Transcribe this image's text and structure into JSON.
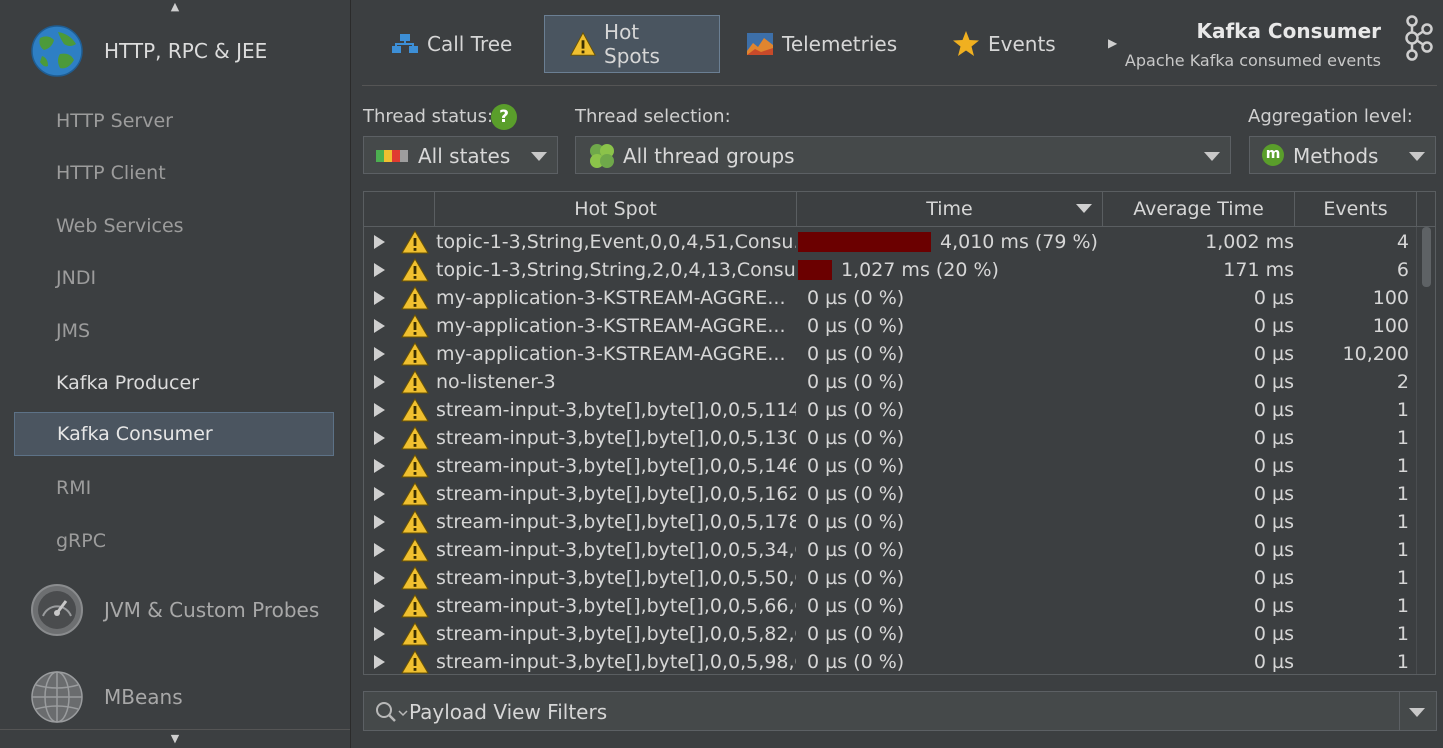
{
  "sidebar": {
    "categories": [
      {
        "label": "HTTP, RPC & JEE",
        "icon": "globe-icon"
      },
      {
        "label": "JVM & Custom Probes",
        "icon": "gauge-icon"
      },
      {
        "label": "MBeans",
        "icon": "wireframe-globe-icon"
      }
    ],
    "items": [
      {
        "label": "HTTP Server"
      },
      {
        "label": "HTTP Client"
      },
      {
        "label": "Web Services"
      },
      {
        "label": "JNDI"
      },
      {
        "label": "JMS"
      },
      {
        "label": "Kafka Producer"
      },
      {
        "label": "Kafka Consumer",
        "selected": true
      },
      {
        "label": "RMI"
      },
      {
        "label": "gRPC"
      }
    ]
  },
  "tabs": [
    {
      "label": "Call Tree",
      "icon": "call-tree-icon"
    },
    {
      "label": "Hot Spots",
      "icon": "warning-icon",
      "active": true
    },
    {
      "label": "Telemetries",
      "icon": "telemetry-chart-icon"
    },
    {
      "label": "Events",
      "icon": "star-icon"
    }
  ],
  "view": {
    "title": "Kafka Consumer",
    "subtitle": "Apache Kafka consumed events"
  },
  "filters": {
    "thread_status_label": "Thread status:",
    "thread_status_help": "?",
    "thread_status_value": "All states",
    "thread_selection_label": "Thread selection:",
    "thread_selection_value": "All thread groups",
    "aggregation_label": "Aggregation level:",
    "aggregation_badge": "m",
    "aggregation_value": "Methods"
  },
  "table": {
    "columns": [
      "Hot Spot",
      "Time",
      "Average Time",
      "Events"
    ],
    "sort_column": "Time",
    "rows": [
      {
        "name": "topic-1-3,String,Event,0,0,4,51,Consu...",
        "bar_fraction": 0.79,
        "time": "4,010 ms (79 %)",
        "avg": "1,002 ms",
        "events": "4"
      },
      {
        "name": "topic-1-3,String,String,2,0,4,13,Consu...",
        "bar_fraction": 0.2,
        "time": "1,027 ms (20 %)",
        "avg": "171 ms",
        "events": "6"
      },
      {
        "name": "my-application-3-KSTREAM-AGGRE...",
        "bar_fraction": 0,
        "time": "0 µs (0 %)",
        "avg": "0 µs",
        "events": "100"
      },
      {
        "name": "my-application-3-KSTREAM-AGGRE...",
        "bar_fraction": 0,
        "time": "0 µs (0 %)",
        "avg": "0 µs",
        "events": "100"
      },
      {
        "name": "my-application-3-KSTREAM-AGGRE...",
        "bar_fraction": 0,
        "time": "0 µs (0 %)",
        "avg": "0 µs",
        "events": "10,200"
      },
      {
        "name": "no-listener-3",
        "bar_fraction": 0,
        "time": "0 µs (0 %)",
        "avg": "0 µs",
        "events": "2"
      },
      {
        "name": "stream-input-3,byte[],byte[],0,0,5,114,...",
        "bar_fraction": 0,
        "time": "0 µs (0 %)",
        "avg": "0 µs",
        "events": "1"
      },
      {
        "name": "stream-input-3,byte[],byte[],0,0,5,130,...",
        "bar_fraction": 0,
        "time": "0 µs (0 %)",
        "avg": "0 µs",
        "events": "1"
      },
      {
        "name": "stream-input-3,byte[],byte[],0,0,5,146,...",
        "bar_fraction": 0,
        "time": "0 µs (0 %)",
        "avg": "0 µs",
        "events": "1"
      },
      {
        "name": "stream-input-3,byte[],byte[],0,0,5,162,...",
        "bar_fraction": 0,
        "time": "0 µs (0 %)",
        "avg": "0 µs",
        "events": "1"
      },
      {
        "name": "stream-input-3,byte[],byte[],0,0,5,178,...",
        "bar_fraction": 0,
        "time": "0 µs (0 %)",
        "avg": "0 µs",
        "events": "1"
      },
      {
        "name": "stream-input-3,byte[],byte[],0,0,5,34,C...",
        "bar_fraction": 0,
        "time": "0 µs (0 %)",
        "avg": "0 µs",
        "events": "1"
      },
      {
        "name": "stream-input-3,byte[],byte[],0,0,5,50,C...",
        "bar_fraction": 0,
        "time": "0 µs (0 %)",
        "avg": "0 µs",
        "events": "1"
      },
      {
        "name": "stream-input-3,byte[],byte[],0,0,5,66,C...",
        "bar_fraction": 0,
        "time": "0 µs (0 %)",
        "avg": "0 µs",
        "events": "1"
      },
      {
        "name": "stream-input-3,byte[],byte[],0,0,5,82,C...",
        "bar_fraction": 0,
        "time": "0 µs (0 %)",
        "avg": "0 µs",
        "events": "1"
      },
      {
        "name": "stream-input-3,byte[],byte[],0,0,5,98,C...",
        "bar_fraction": 0,
        "time": "0 µs (0 %)",
        "avg": "0 µs",
        "events": "1"
      }
    ]
  },
  "payload_filter": {
    "placeholder": "Payload View Filters"
  },
  "colors": {
    "background": "#3c3f41",
    "selection": "#4b5560",
    "bar": "#6b0000",
    "warning": "#f0c030",
    "help_green": "#5a9e2b"
  }
}
